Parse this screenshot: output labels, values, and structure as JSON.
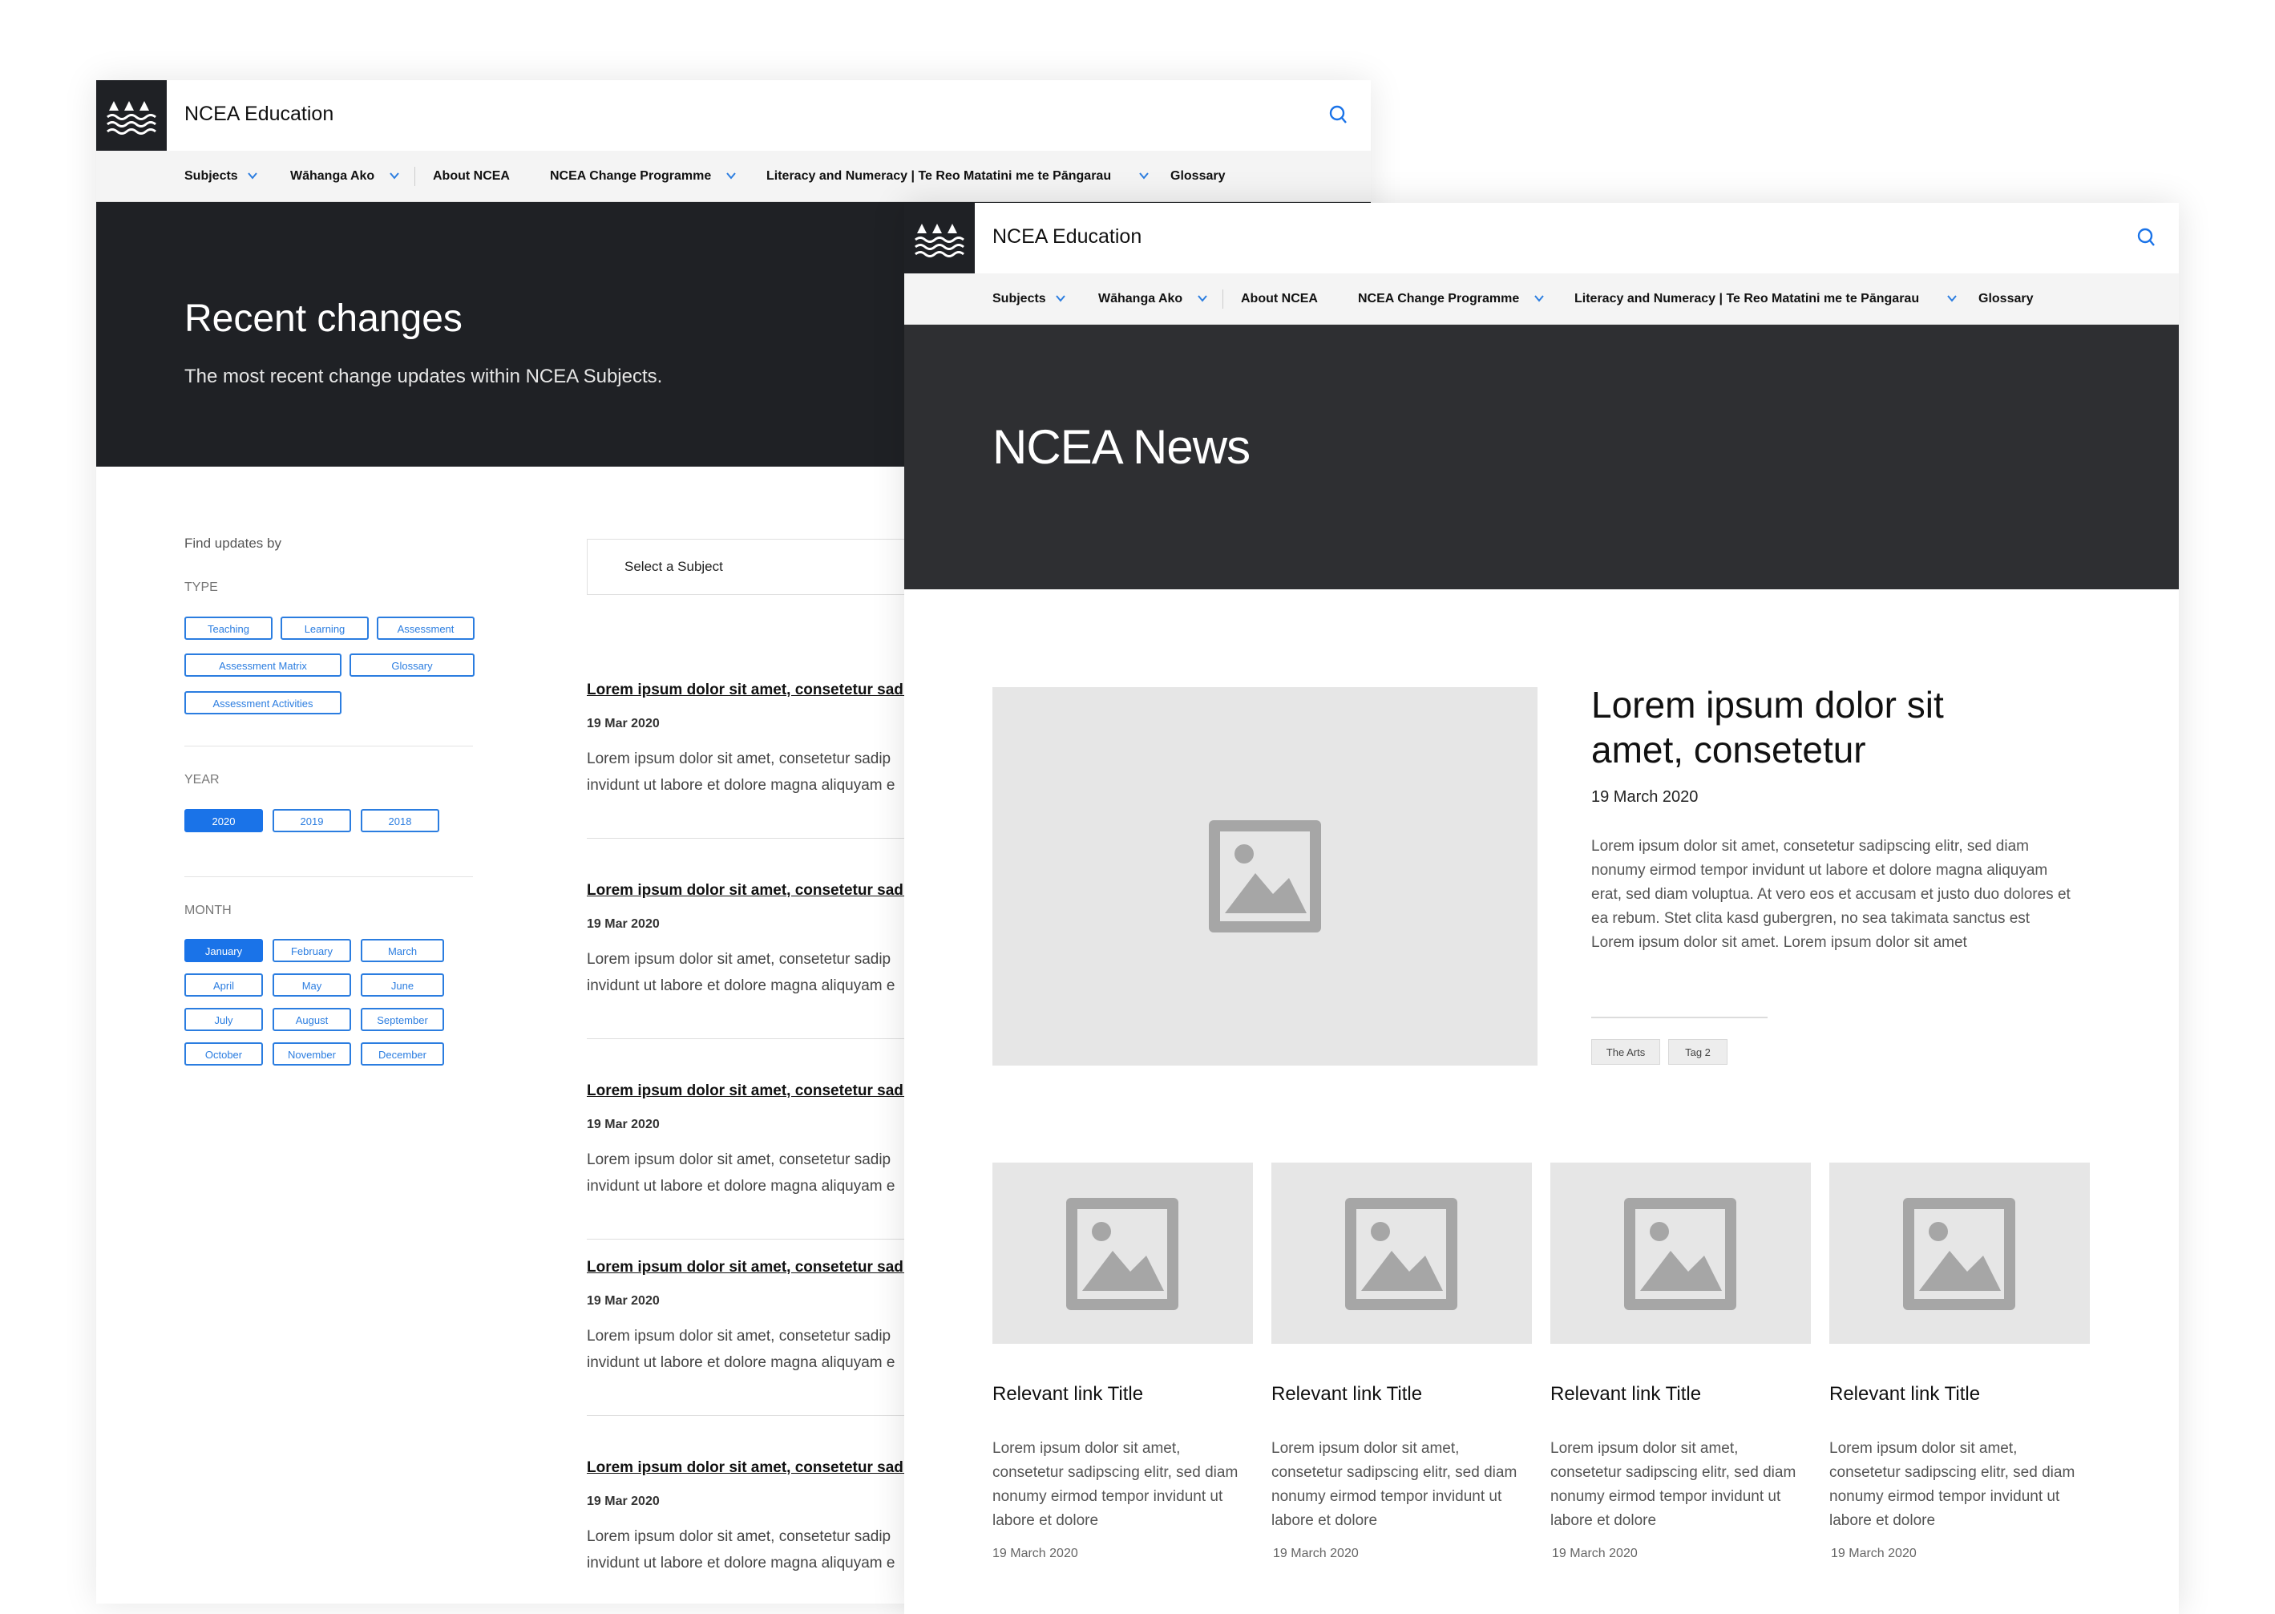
{
  "colors": {
    "accent": "#1a73e8",
    "hero_dark": "#1f2125",
    "hero_dark_2": "#2e2f32",
    "placeholder": "#e6e6e6"
  },
  "header": {
    "logo_icon": "waves-logo-icon",
    "title": "NCEA Education",
    "search_icon": "search-icon"
  },
  "nav": {
    "items": [
      {
        "label": "Subjects"
      },
      {
        "label": "Wāhanga Ako"
      },
      {
        "label": "About NCEA"
      },
      {
        "label": "NCEA Change Programme"
      },
      {
        "label": "Literacy and Numeracy | Te Reo Matatini me te Pāngarau"
      },
      {
        "label": "Glossary"
      }
    ],
    "chevron_icon": "chevron-down-icon"
  },
  "recent": {
    "title": "Recent changes",
    "subtitle": "The most recent change updates within NCEA Subjects.",
    "find_label": "Find updates by",
    "type_label": "TYPE",
    "type_chips": [
      "Teaching",
      "Learning",
      "Assessment",
      "Assessment Matrix",
      "Glossary",
      "Assessment Activities"
    ],
    "year_label": "YEAR",
    "year_chips": [
      "2020",
      "2019",
      "2018"
    ],
    "selected_year": "2020",
    "month_label": "MONTH",
    "month_chips": [
      "January",
      "February",
      "March",
      "April",
      "May",
      "June",
      "July",
      "August",
      "September",
      "October",
      "November",
      "December"
    ],
    "selected_month": "January",
    "select_placeholder": "Select a Subject",
    "entries": [
      {
        "title": "Lorem ipsum dolor sit amet, consetetur sadi",
        "date": "19 Mar 2020",
        "line1": "Lorem ipsum dolor sit amet, consetetur sadip",
        "line2": "invidunt ut labore et dolore magna aliquyam e"
      },
      {
        "title": "Lorem ipsum dolor sit amet, consetetur sadi",
        "date": "19 Mar 2020",
        "line1": "Lorem ipsum dolor sit amet, consetetur sadip",
        "line2": "invidunt ut labore et dolore magna aliquyam e"
      },
      {
        "title": "Lorem ipsum dolor sit amet, consetetur sadi",
        "date": "19 Mar 2020",
        "line1": "Lorem ipsum dolor sit amet, consetetur sadip",
        "line2": "invidunt ut labore et dolore magna aliquyam e"
      },
      {
        "title": "Lorem ipsum dolor sit amet, consetetur sadi",
        "date": "19 Mar 2020",
        "line1": "Lorem ipsum dolor sit amet, consetetur sadip",
        "line2": "invidunt ut labore et dolore magna aliquyam e"
      },
      {
        "title": "Lorem ipsum dolor sit amet, consetetur sadi",
        "date": "19 Mar 2020",
        "line1": "Lorem ipsum dolor sit amet, consetetur sadip",
        "line2": "invidunt ut labore et dolore magna aliquyam e"
      }
    ]
  },
  "news": {
    "title": "NCEA News",
    "featured": {
      "image_icon": "image-placeholder-icon",
      "title": "Lorem ipsum dolor sit amet, consetetur",
      "date": "19 March 2020",
      "text": "Lorem ipsum dolor sit amet, consetetur sadipscing elitr, sed diam nonumy eirmod tempor invidunt ut labore et dolore magna aliquyam erat, sed diam voluptua. At vero eos et accusam et justo duo dolores et ea rebum. Stet clita kasd gubergren, no sea takimata sanctus est Lorem ipsum dolor sit amet. Lorem ipsum dolor sit amet",
      "tags": [
        "The Arts",
        "Tag 2"
      ]
    },
    "cards": [
      {
        "title": "Relevant link Title",
        "text": "Lorem ipsum dolor sit amet, consetetur sadipscing elitr, sed diam nonumy eirmod tempor invidunt ut labore et dolore",
        "date": "19 March 2020"
      },
      {
        "title": "Relevant link Title",
        "text": "Lorem ipsum dolor sit amet, consetetur sadipscing elitr, sed diam nonumy eirmod tempor invidunt ut labore et dolore",
        "date": "19 March 2020"
      },
      {
        "title": "Relevant link Title",
        "text": "Lorem ipsum dolor sit amet, consetetur sadipscing elitr, sed diam nonumy eirmod tempor invidunt ut labore et dolore",
        "date": "19 March 2020"
      },
      {
        "title": "Relevant link Title",
        "text": "Lorem ipsum dolor sit amet, consetetur sadipscing elitr, sed diam nonumy eirmod tempor invidunt ut labore et dolore",
        "date": "19 March 2020"
      }
    ]
  }
}
